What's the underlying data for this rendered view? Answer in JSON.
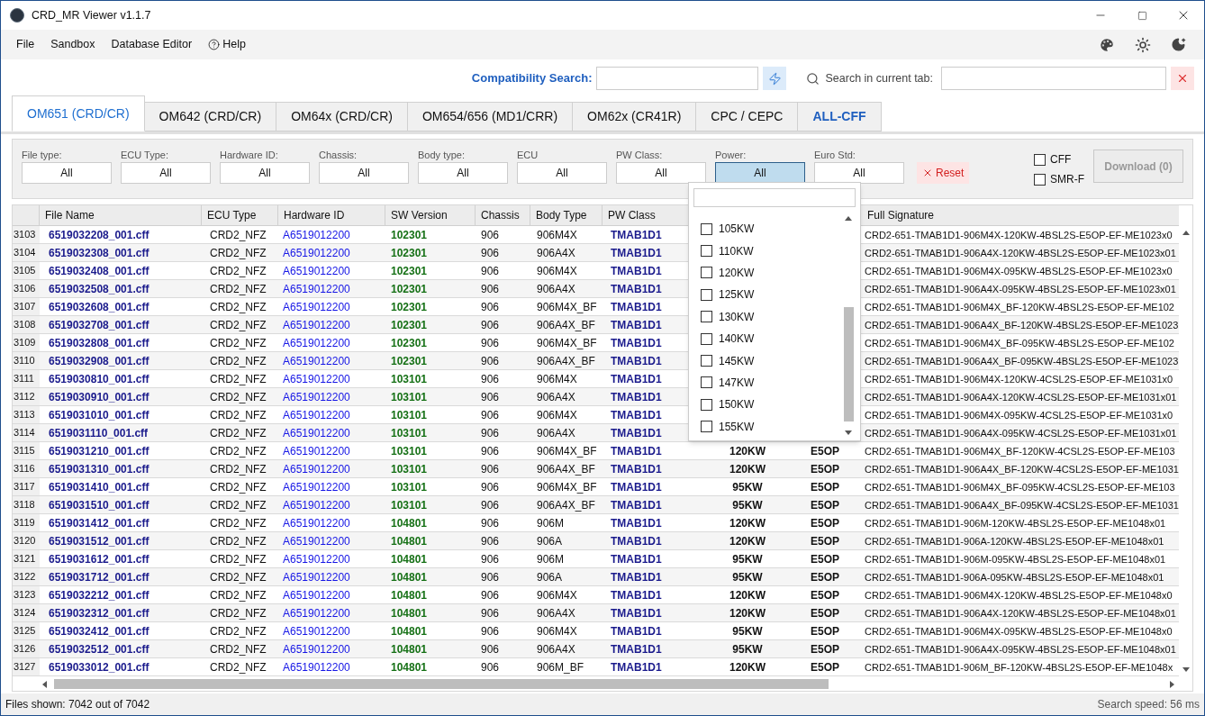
{
  "window": {
    "title": "CRD_MR Viewer v1.1.7"
  },
  "menu": [
    "File",
    "Sandbox",
    "Database Editor",
    "Help"
  ],
  "search_bar": {
    "compat_label": "Compatibility Search:",
    "tab_search_label": "Search in current tab:"
  },
  "tabs": [
    {
      "label": "OM651 (CRD/CR)",
      "selected": true,
      "highlighted": false
    },
    {
      "label": "OM642 (CRD/CR)",
      "selected": false,
      "highlighted": false
    },
    {
      "label": "OM64x (CRD/CR)",
      "selected": false,
      "highlighted": false
    },
    {
      "label": "OM654/656 (MD1/CRR)",
      "selected": false,
      "highlighted": false
    },
    {
      "label": "OM62x (CR41R)",
      "selected": false,
      "highlighted": false
    },
    {
      "label": "CPC / CEPC",
      "selected": false,
      "highlighted": false
    },
    {
      "label": "ALL-CFF",
      "selected": false,
      "highlighted": true
    }
  ],
  "filters": [
    {
      "label": "File type:",
      "value": "All",
      "open": false
    },
    {
      "label": "ECU Type:",
      "value": "All",
      "open": false
    },
    {
      "label": "Hardware ID:",
      "value": "All",
      "open": false
    },
    {
      "label": "Chassis:",
      "value": "All",
      "open": false
    },
    {
      "label": "Body type:",
      "value": "All",
      "open": false
    },
    {
      "label": "ECU",
      "value": "All",
      "open": false
    },
    {
      "label": "PW Class:",
      "value": "All",
      "open": false
    },
    {
      "label": "Power:",
      "value": "All",
      "open": true
    },
    {
      "label": "Euro Std:",
      "value": "All",
      "open": false
    }
  ],
  "reset_button": "Reset",
  "options": [
    {
      "label": "CFF",
      "checked": false
    },
    {
      "label": "SMR-F",
      "checked": false
    }
  ],
  "download_button": {
    "label": "Download (0)",
    "disabled": true
  },
  "power_dropdown": {
    "items": [
      {
        "label": "105KW",
        "checked": false
      },
      {
        "label": "110KW",
        "checked": false
      },
      {
        "label": "120KW",
        "checked": false
      },
      {
        "label": "125KW",
        "checked": false
      },
      {
        "label": "130KW",
        "checked": false
      },
      {
        "label": "140KW",
        "checked": false
      },
      {
        "label": "145KW",
        "checked": false
      },
      {
        "label": "147KW",
        "checked": false
      },
      {
        "label": "150KW",
        "checked": false
      },
      {
        "label": "155KW",
        "checked": false
      }
    ]
  },
  "table": {
    "columns": [
      "File Name",
      "ECU Type",
      "Hardware ID",
      "SW Version",
      "Chassis",
      "Body Type",
      "PW Class",
      "Full Signature"
    ],
    "rows": [
      {
        "n": "3103",
        "file": "6519032208_001.cff",
        "ecu": "CRD2_NFZ",
        "hw": "A6519012200",
        "sw": "102301",
        "chassis": "906",
        "body": "906M4X",
        "pw": "TMAB1D1",
        "sig": "CRD2-651-TMAB1D1-906M4X-120KW-4BSL2S-E5OP-EF-ME1023x0"
      },
      {
        "n": "3104",
        "file": "6519032308_001.cff",
        "ecu": "CRD2_NFZ",
        "hw": "A6519012200",
        "sw": "102301",
        "chassis": "906",
        "body": "906A4X",
        "pw": "TMAB1D1",
        "sig": "CRD2-651-TMAB1D1-906A4X-120KW-4BSL2S-E5OP-EF-ME1023x01"
      },
      {
        "n": "3105",
        "file": "6519032408_001.cff",
        "ecu": "CRD2_NFZ",
        "hw": "A6519012200",
        "sw": "102301",
        "chassis": "906",
        "body": "906M4X",
        "pw": "TMAB1D1",
        "sig": "CRD2-651-TMAB1D1-906M4X-095KW-4BSL2S-E5OP-EF-ME1023x0"
      },
      {
        "n": "3106",
        "file": "6519032508_001.cff",
        "ecu": "CRD2_NFZ",
        "hw": "A6519012200",
        "sw": "102301",
        "chassis": "906",
        "body": "906A4X",
        "pw": "TMAB1D1",
        "sig": "CRD2-651-TMAB1D1-906A4X-095KW-4BSL2S-E5OP-EF-ME1023x01"
      },
      {
        "n": "3107",
        "file": "6519032608_001.cff",
        "ecu": "CRD2_NFZ",
        "hw": "A6519012200",
        "sw": "102301",
        "chassis": "906",
        "body": "906M4X_BF",
        "pw": "TMAB1D1",
        "sig": "CRD2-651-TMAB1D1-906M4X_BF-120KW-4BSL2S-E5OP-EF-ME102"
      },
      {
        "n": "3108",
        "file": "6519032708_001.cff",
        "ecu": "CRD2_NFZ",
        "hw": "A6519012200",
        "sw": "102301",
        "chassis": "906",
        "body": "906A4X_BF",
        "pw": "TMAB1D1",
        "sig": "CRD2-651-TMAB1D1-906A4X_BF-120KW-4BSL2S-E5OP-EF-ME1023"
      },
      {
        "n": "3109",
        "file": "6519032808_001.cff",
        "ecu": "CRD2_NFZ",
        "hw": "A6519012200",
        "sw": "102301",
        "chassis": "906",
        "body": "906M4X_BF",
        "pw": "TMAB1D1",
        "sig": "CRD2-651-TMAB1D1-906M4X_BF-095KW-4BSL2S-E5OP-EF-ME102"
      },
      {
        "n": "3110",
        "file": "6519032908_001.cff",
        "ecu": "CRD2_NFZ",
        "hw": "A6519012200",
        "sw": "102301",
        "chassis": "906",
        "body": "906A4X_BF",
        "pw": "TMAB1D1",
        "sig": "CRD2-651-TMAB1D1-906A4X_BF-095KW-4BSL2S-E5OP-EF-ME1023"
      },
      {
        "n": "3111",
        "file": "6519030810_001.cff",
        "ecu": "CRD2_NFZ",
        "hw": "A6519012200",
        "sw": "103101",
        "chassis": "906",
        "body": "906M4X",
        "pw": "TMAB1D1",
        "sig": "CRD2-651-TMAB1D1-906M4X-120KW-4CSL2S-E5OP-EF-ME1031x0"
      },
      {
        "n": "3112",
        "file": "6519030910_001.cff",
        "ecu": "CRD2_NFZ",
        "hw": "A6519012200",
        "sw": "103101",
        "chassis": "906",
        "body": "906A4X",
        "pw": "TMAB1D1",
        "sig": "CRD2-651-TMAB1D1-906A4X-120KW-4CSL2S-E5OP-EF-ME1031x01"
      },
      {
        "n": "3113",
        "file": "6519031010_001.cff",
        "ecu": "CRD2_NFZ",
        "hw": "A6519012200",
        "sw": "103101",
        "chassis": "906",
        "body": "906M4X",
        "pw": "TMAB1D1",
        "sig": "CRD2-651-TMAB1D1-906M4X-095KW-4CSL2S-E5OP-EF-ME1031x0"
      },
      {
        "n": "3114",
        "file": "6519031110_001.cff",
        "ecu": "CRD2_NFZ",
        "hw": "A6519012200",
        "sw": "103101",
        "chassis": "906",
        "body": "906A4X",
        "pw": "TMAB1D1",
        "sig": "CRD2-651-TMAB1D1-906A4X-095KW-4CSL2S-E5OP-EF-ME1031x01"
      },
      {
        "n": "3115",
        "file": "6519031210_001.cff",
        "ecu": "CRD2_NFZ",
        "hw": "A6519012200",
        "sw": "103101",
        "chassis": "906",
        "body": "906M4X_BF",
        "pw": "TMAB1D1",
        "power": "120KW",
        "euro": "E5OP",
        "sig": "CRD2-651-TMAB1D1-906M4X_BF-120KW-4CSL2S-E5OP-EF-ME103"
      },
      {
        "n": "3116",
        "file": "6519031310_001.cff",
        "ecu": "CRD2_NFZ",
        "hw": "A6519012200",
        "sw": "103101",
        "chassis": "906",
        "body": "906A4X_BF",
        "pw": "TMAB1D1",
        "power": "120KW",
        "euro": "E5OP",
        "sig": "CRD2-651-TMAB1D1-906A4X_BF-120KW-4CSL2S-E5OP-EF-ME1031"
      },
      {
        "n": "3117",
        "file": "6519031410_001.cff",
        "ecu": "CRD2_NFZ",
        "hw": "A6519012200",
        "sw": "103101",
        "chassis": "906",
        "body": "906M4X_BF",
        "pw": "TMAB1D1",
        "power": "95KW",
        "euro": "E5OP",
        "sig": "CRD2-651-TMAB1D1-906M4X_BF-095KW-4CSL2S-E5OP-EF-ME103"
      },
      {
        "n": "3118",
        "file": "6519031510_001.cff",
        "ecu": "CRD2_NFZ",
        "hw": "A6519012200",
        "sw": "103101",
        "chassis": "906",
        "body": "906A4X_BF",
        "pw": "TMAB1D1",
        "power": "95KW",
        "euro": "E5OP",
        "sig": "CRD2-651-TMAB1D1-906A4X_BF-095KW-4CSL2S-E5OP-EF-ME1031"
      },
      {
        "n": "3119",
        "file": "6519031412_001.cff",
        "ecu": "CRD2_NFZ",
        "hw": "A6519012200",
        "sw": "104801",
        "chassis": "906",
        "body": "906M",
        "pw": "TMAB1D1",
        "power": "120KW",
        "euro": "E5OP",
        "sig": "CRD2-651-TMAB1D1-906M-120KW-4BSL2S-E5OP-EF-ME1048x01"
      },
      {
        "n": "3120",
        "file": "6519031512_001.cff",
        "ecu": "CRD2_NFZ",
        "hw": "A6519012200",
        "sw": "104801",
        "chassis": "906",
        "body": "906A",
        "pw": "TMAB1D1",
        "power": "120KW",
        "euro": "E5OP",
        "sig": "CRD2-651-TMAB1D1-906A-120KW-4BSL2S-E5OP-EF-ME1048x01"
      },
      {
        "n": "3121",
        "file": "6519031612_001.cff",
        "ecu": "CRD2_NFZ",
        "hw": "A6519012200",
        "sw": "104801",
        "chassis": "906",
        "body": "906M",
        "pw": "TMAB1D1",
        "power": "95KW",
        "euro": "E5OP",
        "sig": "CRD2-651-TMAB1D1-906M-095KW-4BSL2S-E5OP-EF-ME1048x01"
      },
      {
        "n": "3122",
        "file": "6519031712_001.cff",
        "ecu": "CRD2_NFZ",
        "hw": "A6519012200",
        "sw": "104801",
        "chassis": "906",
        "body": "906A",
        "pw": "TMAB1D1",
        "power": "95KW",
        "euro": "E5OP",
        "sig": "CRD2-651-TMAB1D1-906A-095KW-4BSL2S-E5OP-EF-ME1048x01"
      },
      {
        "n": "3123",
        "file": "6519032212_001.cff",
        "ecu": "CRD2_NFZ",
        "hw": "A6519012200",
        "sw": "104801",
        "chassis": "906",
        "body": "906M4X",
        "pw": "TMAB1D1",
        "power": "120KW",
        "euro": "E5OP",
        "sig": "CRD2-651-TMAB1D1-906M4X-120KW-4BSL2S-E5OP-EF-ME1048x0"
      },
      {
        "n": "3124",
        "file": "6519032312_001.cff",
        "ecu": "CRD2_NFZ",
        "hw": "A6519012200",
        "sw": "104801",
        "chassis": "906",
        "body": "906A4X",
        "pw": "TMAB1D1",
        "power": "120KW",
        "euro": "E5OP",
        "sig": "CRD2-651-TMAB1D1-906A4X-120KW-4BSL2S-E5OP-EF-ME1048x01"
      },
      {
        "n": "3125",
        "file": "6519032412_001.cff",
        "ecu": "CRD2_NFZ",
        "hw": "A6519012200",
        "sw": "104801",
        "chassis": "906",
        "body": "906M4X",
        "pw": "TMAB1D1",
        "power": "95KW",
        "euro": "E5OP",
        "sig": "CRD2-651-TMAB1D1-906M4X-095KW-4BSL2S-E5OP-EF-ME1048x0"
      },
      {
        "n": "3126",
        "file": "6519032512_001.cff",
        "ecu": "CRD2_NFZ",
        "hw": "A6519012200",
        "sw": "104801",
        "chassis": "906",
        "body": "906A4X",
        "pw": "TMAB1D1",
        "power": "95KW",
        "euro": "E5OP",
        "sig": "CRD2-651-TMAB1D1-906A4X-095KW-4BSL2S-E5OP-EF-ME1048x01"
      },
      {
        "n": "3127",
        "file": "6519033012_001.cff",
        "ecu": "CRD2_NFZ",
        "hw": "A6519012200",
        "sw": "104801",
        "chassis": "906",
        "body": "906M_BF",
        "pw": "TMAB1D1",
        "power": "120KW",
        "euro": "E5OP",
        "sig": "CRD2-651-TMAB1D1-906M_BF-120KW-4BSL2S-E5OP-EF-ME1048x"
      }
    ]
  },
  "status_bar": {
    "left": "Files shown: 7042 out of 7042",
    "right": "Search speed: 56 ms"
  }
}
